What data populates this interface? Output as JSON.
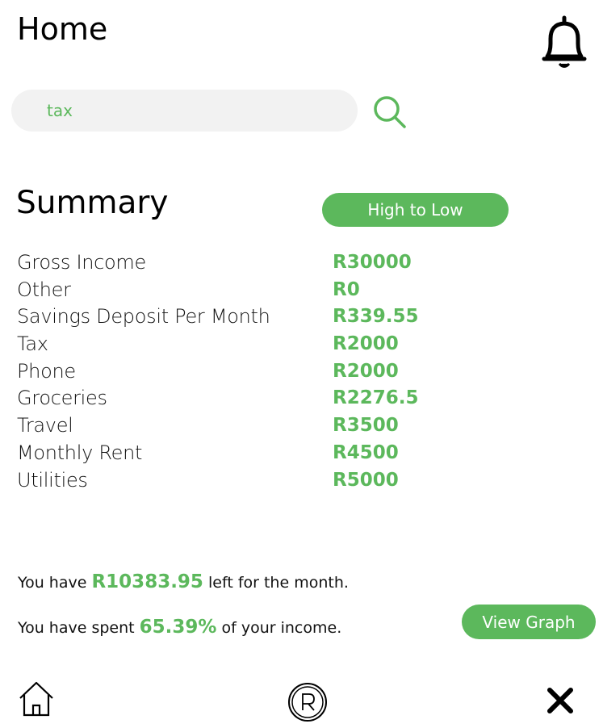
{
  "header": {
    "title": "Home"
  },
  "search": {
    "value": "tax"
  },
  "summary": {
    "title": "Summary",
    "sort_label": "High to Low",
    "items": [
      {
        "label": "Gross Income",
        "value": "R30000"
      },
      {
        "label": "Other",
        "value": "R0"
      },
      {
        "label": "Savings Deposit Per Month",
        "value": "R339.55"
      },
      {
        "label": "Tax",
        "value": "R2000"
      },
      {
        "label": "Phone",
        "value": "R2000"
      },
      {
        "label": "Groceries",
        "value": "R2276.5"
      },
      {
        "label": "Travel",
        "value": "R3500"
      },
      {
        "label": "Monthly Rent",
        "value": "R4500"
      },
      {
        "label": "Utilities",
        "value": "R5000"
      }
    ]
  },
  "stats": {
    "left_prefix": "You have",
    "left_amount": "R10383.95",
    "left_suffix": "left for the month.",
    "spent_prefix": "You have spent",
    "spent_percent": "65.39%",
    "spent_suffix": "of your income."
  },
  "graph_button": "View Graph",
  "icons": {
    "bell": "bell-icon",
    "search": "search-icon",
    "home": "home-icon",
    "r": "registered-icon",
    "close": "close-icon"
  },
  "colors": {
    "accent": "#5cb85c",
    "search_bg": "#f2f2f2"
  }
}
